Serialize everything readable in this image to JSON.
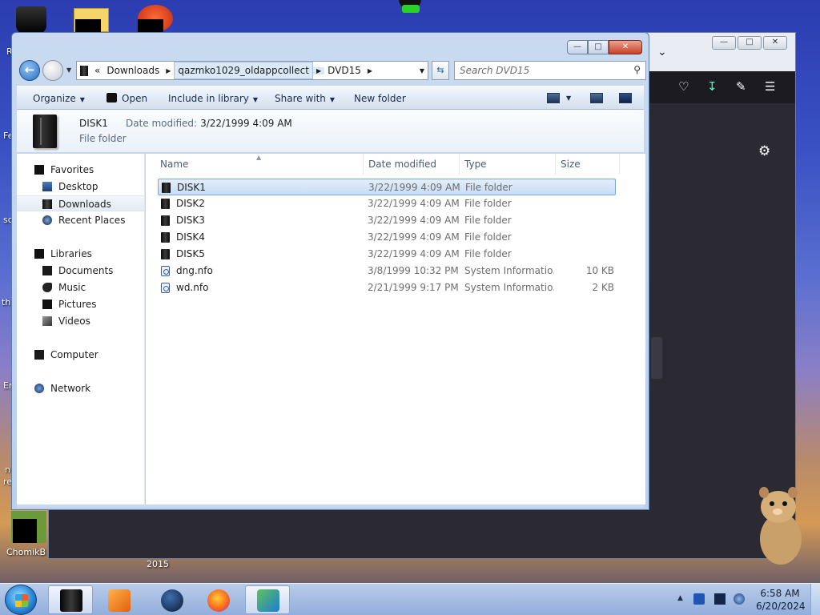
{
  "desktop": {
    "left_labels": [
      "R",
      "Fe",
      "sc",
      "th",
      "Er",
      "n",
      "re"
    ],
    "chomik_label": "ChomikB",
    "year_label": "2015"
  },
  "firefox": {
    "minimize": "—",
    "maximize": "□",
    "close": "✕"
  },
  "explorer": {
    "window_controls": {
      "minimize": "—",
      "maximize": "□",
      "close": "✕"
    },
    "address": {
      "prefix": "«",
      "segments": [
        "Downloads",
        "qazmko1029_oldappcollect",
        "DVD15"
      ]
    },
    "search": {
      "placeholder": "Search DVD15"
    },
    "toolbar": {
      "organize": "Organize",
      "open": "Open",
      "include_in_library": "Include in library",
      "share_with": "Share with",
      "new_folder": "New folder"
    },
    "details": {
      "name": "DISK1",
      "type": "File folder",
      "modified_label": "Date modified:",
      "modified_value": "3/22/1999 4:09 AM"
    },
    "nav": {
      "favorites": "Favorites",
      "desktop": "Desktop",
      "downloads": "Downloads",
      "recent_places": "Recent Places",
      "libraries": "Libraries",
      "documents": "Documents",
      "music": "Music",
      "pictures": "Pictures",
      "videos": "Videos",
      "computer": "Computer",
      "network": "Network"
    },
    "columns": {
      "name": "Name",
      "date_modified": "Date modified",
      "type": "Type",
      "size": "Size"
    },
    "files": [
      {
        "name": "DISK1",
        "date": "3/22/1999 4:09 AM",
        "type": "File folder",
        "size": "",
        "icon": "folder-icon"
      },
      {
        "name": "DISK2",
        "date": "3/22/1999 4:09 AM",
        "type": "File folder",
        "size": "",
        "icon": "folder-icon"
      },
      {
        "name": "DISK3",
        "date": "3/22/1999 4:09 AM",
        "type": "File folder",
        "size": "",
        "icon": "folder-icon"
      },
      {
        "name": "DISK4",
        "date": "3/22/1999 4:09 AM",
        "type": "File folder",
        "size": "",
        "icon": "folder-icon"
      },
      {
        "name": "DISK5",
        "date": "3/22/1999 4:09 AM",
        "type": "File folder",
        "size": "",
        "icon": "folder-icon"
      },
      {
        "name": "dng.nfo",
        "date": "3/8/1999 10:32 PM",
        "type": "System Informatio...",
        "size": "10 KB",
        "icon": "nfo-file-icon"
      },
      {
        "name": "wd.nfo",
        "date": "2/21/1999 9:17 PM",
        "type": "System Informatio...",
        "size": "2 KB",
        "icon": "nfo-file-icon"
      }
    ]
  },
  "taskbar": {
    "clock_time": "6:58 AM",
    "clock_date": "6/20/2024",
    "tray_up": "▲"
  },
  "colors": {
    "selection": "#c9ddf5",
    "window_frame": "#c9daf0",
    "firefox_dark": "#2b2a33"
  }
}
